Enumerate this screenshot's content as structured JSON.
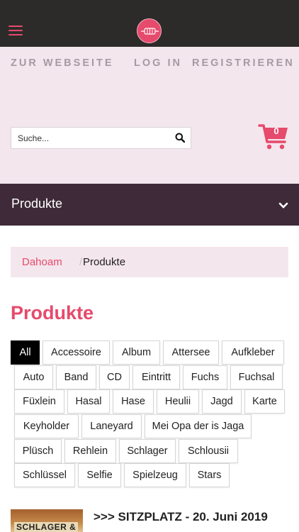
{
  "header": {
    "menu_icon": "hamburger-icon",
    "logo_icon": "band-logo-icon",
    "brand_color": "#e64a6c"
  },
  "nav": {
    "website": "ZUR WEBSEITE",
    "login": "LOG IN",
    "register": "REGISTRIEREN"
  },
  "search": {
    "placeholder": "Suche...",
    "icon": "search-icon"
  },
  "cart": {
    "count": "0",
    "icon": "shopping-cart-icon"
  },
  "category_bar": {
    "label": "Produkte",
    "icon": "chevron-down-icon"
  },
  "breadcrumb": {
    "home": "Dahoam",
    "separator": "/",
    "current": "Produkte"
  },
  "page_title": "Produkte",
  "tags": [
    "All",
    "Accessoire",
    "Album",
    "Attersee",
    "Aufkleber",
    "Auto",
    "Band",
    "CD",
    "Eintritt",
    "Fuchs",
    "Fuchsal",
    "Füxlein",
    "Hasal",
    "Hase",
    "Heulii",
    "Jagd",
    "Karte",
    "Keyholder",
    "Laneyard",
    "Mei Opa der is Jaga",
    "Plüsch",
    "Rehlein",
    "Schlager",
    "Schlousii",
    "Schlüssel",
    "Selfie",
    "Spielzeug",
    "Stars"
  ],
  "active_tag": "All",
  "product": {
    "title": ">>> SITZPLATZ - 20. Juni 2019",
    "thumb_text": "SCHLAGER &"
  }
}
